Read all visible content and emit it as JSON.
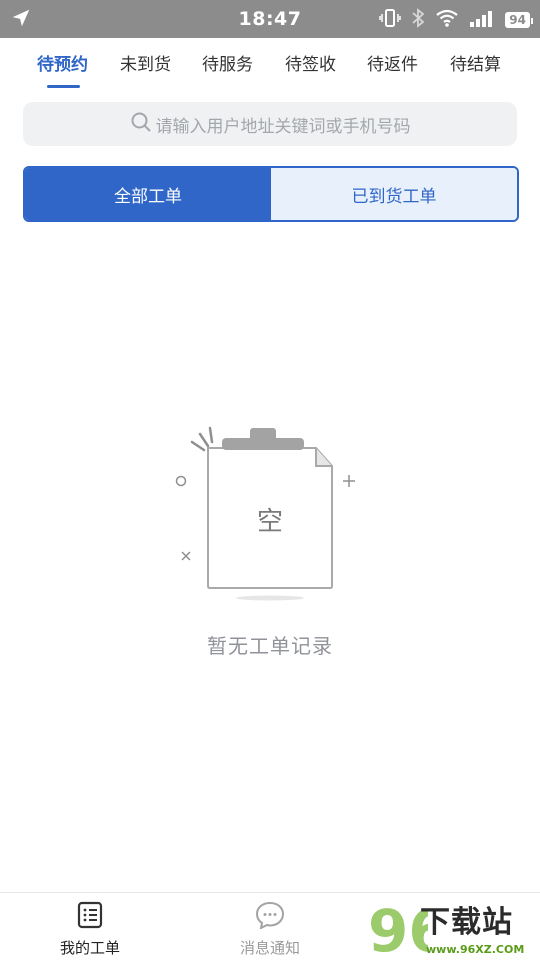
{
  "status_bar": {
    "time": "18:47",
    "battery": "94",
    "icons": [
      "location-arrow-icon",
      "vibrate-icon",
      "bluetooth-icon",
      "wifi-icon",
      "signal-icon",
      "battery-icon"
    ]
  },
  "tabs": [
    {
      "label": "待预约",
      "active": true
    },
    {
      "label": "未到货",
      "active": false
    },
    {
      "label": "待服务",
      "active": false
    },
    {
      "label": "待签收",
      "active": false
    },
    {
      "label": "待返件",
      "active": false
    },
    {
      "label": "待结算",
      "active": false
    }
  ],
  "search": {
    "placeholder": "请输入用户地址关键词或手机号码"
  },
  "segment": {
    "left": "全部工单",
    "right": "已到货工单",
    "selected": "left"
  },
  "empty": {
    "illustration_text": "空",
    "message": "暂无工单记录"
  },
  "bottom_nav": [
    {
      "label": "我的工单",
      "icon": "work-order-list-icon",
      "active": true
    },
    {
      "label": "消息通知",
      "icon": "message-bubble-icon",
      "active": false
    }
  ],
  "watermark": {
    "number": "96",
    "title": "下载站",
    "url": "www.96XZ.COM"
  },
  "colors": {
    "accent": "#2f66c8",
    "status_bar": "#8c8c8c",
    "muted": "#909399"
  }
}
